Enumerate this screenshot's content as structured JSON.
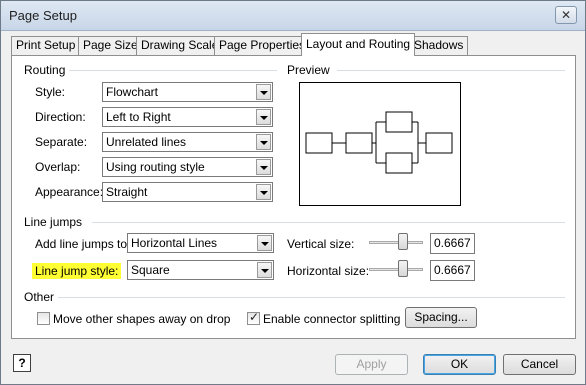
{
  "window": {
    "title": "Page Setup",
    "close_glyph": "✕"
  },
  "tabs": [
    "Print Setup",
    "Page Size",
    "Drawing Scale",
    "Page Properties",
    "Layout and Routing",
    "Shadows"
  ],
  "routing": {
    "section_label": "Routing",
    "style": {
      "label": "Style:",
      "value": "Flowchart"
    },
    "direction": {
      "label": "Direction:",
      "value": "Left to Right"
    },
    "separate": {
      "label": "Separate:",
      "value": "Unrelated lines"
    },
    "overlap": {
      "label": "Overlap:",
      "value": "Using routing style"
    },
    "appearance": {
      "label": "Appearance:",
      "value": "Straight"
    }
  },
  "preview": {
    "section_label": "Preview"
  },
  "line_jumps": {
    "section_label": "Line jumps",
    "add_line_jumps": {
      "label": "Add line jumps to:",
      "value": "Horizontal Lines"
    },
    "line_jump_style": {
      "label": "Line jump style:",
      "value": "Square"
    },
    "vertical_size": {
      "label": "Vertical size:",
      "value": "0.6667"
    },
    "horizontal_size": {
      "label": "Horizontal size:",
      "value": "0.6667"
    },
    "highlight_color": "#ffff33"
  },
  "other": {
    "section_label": "Other",
    "move_shapes": {
      "label": "Move other shapes away on drop",
      "checked": false
    },
    "enable_splitting": {
      "label": "Enable connector splitting",
      "checked": true,
      "check_glyph": "✓"
    },
    "spacing_button": "Spacing..."
  },
  "footer": {
    "help_glyph": "?",
    "apply": "Apply",
    "ok": "OK",
    "cancel": "Cancel"
  }
}
